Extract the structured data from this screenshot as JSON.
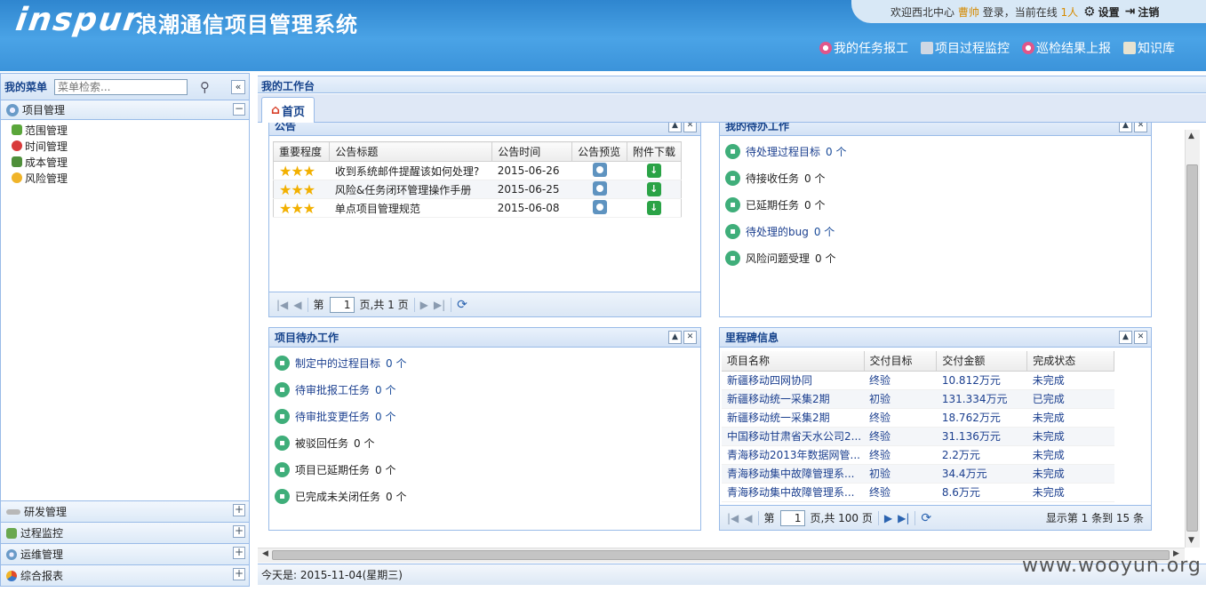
{
  "header": {
    "logo": "inspur",
    "app_name": "浪潮通信项目管理系统",
    "welcome_prefix": "欢迎西北中心",
    "user": "曹帅",
    "login_text": "登录，当前在线",
    "online_count": "1人",
    "settings": "设置",
    "logout": "注销",
    "quick_links": [
      "我的任务报工",
      "项目过程监控",
      "巡检结果上报",
      "知识库"
    ]
  },
  "sidebar": {
    "title": "我的菜单",
    "search_placeholder": "菜单检索...",
    "active_group": "项目管理",
    "tree_items": [
      "范围管理",
      "时间管理",
      "成本管理",
      "风险管理"
    ],
    "bottom_groups": [
      "研发管理",
      "过程监控",
      "运维管理",
      "综合报表"
    ]
  },
  "main": {
    "title": "我的工作台",
    "tab_home": "首页"
  },
  "notice_panel": {
    "title": "公告",
    "columns": [
      "重要程度",
      "公告标题",
      "公告时间",
      "公告预览",
      "附件下载"
    ],
    "rows": [
      {
        "title": "收到系统邮件提醒该如何处理?",
        "date": "2015-06-26"
      },
      {
        "title": "风险&任务闭环管理操作手册",
        "date": "2015-06-25"
      },
      {
        "title": "单点项目管理规范",
        "date": "2015-06-08"
      }
    ],
    "pager": {
      "before": "第",
      "page": "1",
      "after": "页,共 1 页"
    }
  },
  "my_tasks_panel": {
    "title": "我的待办工作",
    "items": [
      {
        "label": "待处理过程目标",
        "count": "0 个"
      },
      {
        "label": "待接收任务",
        "count": "0 个"
      },
      {
        "label": "已延期任务",
        "count": "0 个"
      },
      {
        "label": "待处理的bug",
        "count": "0 个"
      },
      {
        "label": "风险问题受理",
        "count": "0 个"
      }
    ]
  },
  "project_tasks_panel": {
    "title": "项目待办工作",
    "items": [
      {
        "label": "制定中的过程目标",
        "count": "0 个"
      },
      {
        "label": "待审批报工任务",
        "count": "0 个"
      },
      {
        "label": "待审批变更任务",
        "count": "0 个"
      },
      {
        "label": "被驳回任务",
        "count": "0 个"
      },
      {
        "label": "项目已延期任务",
        "count": "0 个"
      },
      {
        "label": "已完成未关闭任务",
        "count": "0 个"
      }
    ]
  },
  "milestone_panel": {
    "title": "里程碑信息",
    "columns": [
      "项目名称",
      "交付目标",
      "交付金额",
      "完成状态"
    ],
    "rows": [
      {
        "name": "新疆移动四网协同",
        "target": "终验",
        "amount": "10.812万元",
        "status": "未完成"
      },
      {
        "name": "新疆移动统一采集2期",
        "target": "初验",
        "amount": "131.334万元",
        "status": "已完成"
      },
      {
        "name": "新疆移动统一采集2期",
        "target": "终验",
        "amount": "18.762万元",
        "status": "未完成"
      },
      {
        "name": "中国移动甘肃省天水公司2...",
        "target": "终验",
        "amount": "31.136万元",
        "status": "未完成"
      },
      {
        "name": "青海移动2013年数据网管...",
        "target": "终验",
        "amount": "2.2万元",
        "status": "未完成"
      },
      {
        "name": "青海移动集中故障管理系...",
        "target": "初验",
        "amount": "34.4万元",
        "status": "未完成"
      },
      {
        "name": "青海移动集中故障管理系...",
        "target": "终验",
        "amount": "8.6万元",
        "status": "未完成"
      }
    ],
    "pager": {
      "before": "第",
      "page": "1",
      "after": "页,共 100 页",
      "display": "显示第 1 条到 15 条"
    }
  },
  "status_bar": {
    "today": "今天是:  2015-11-04(星期三)"
  },
  "watermark": "www.wooyun.org"
}
